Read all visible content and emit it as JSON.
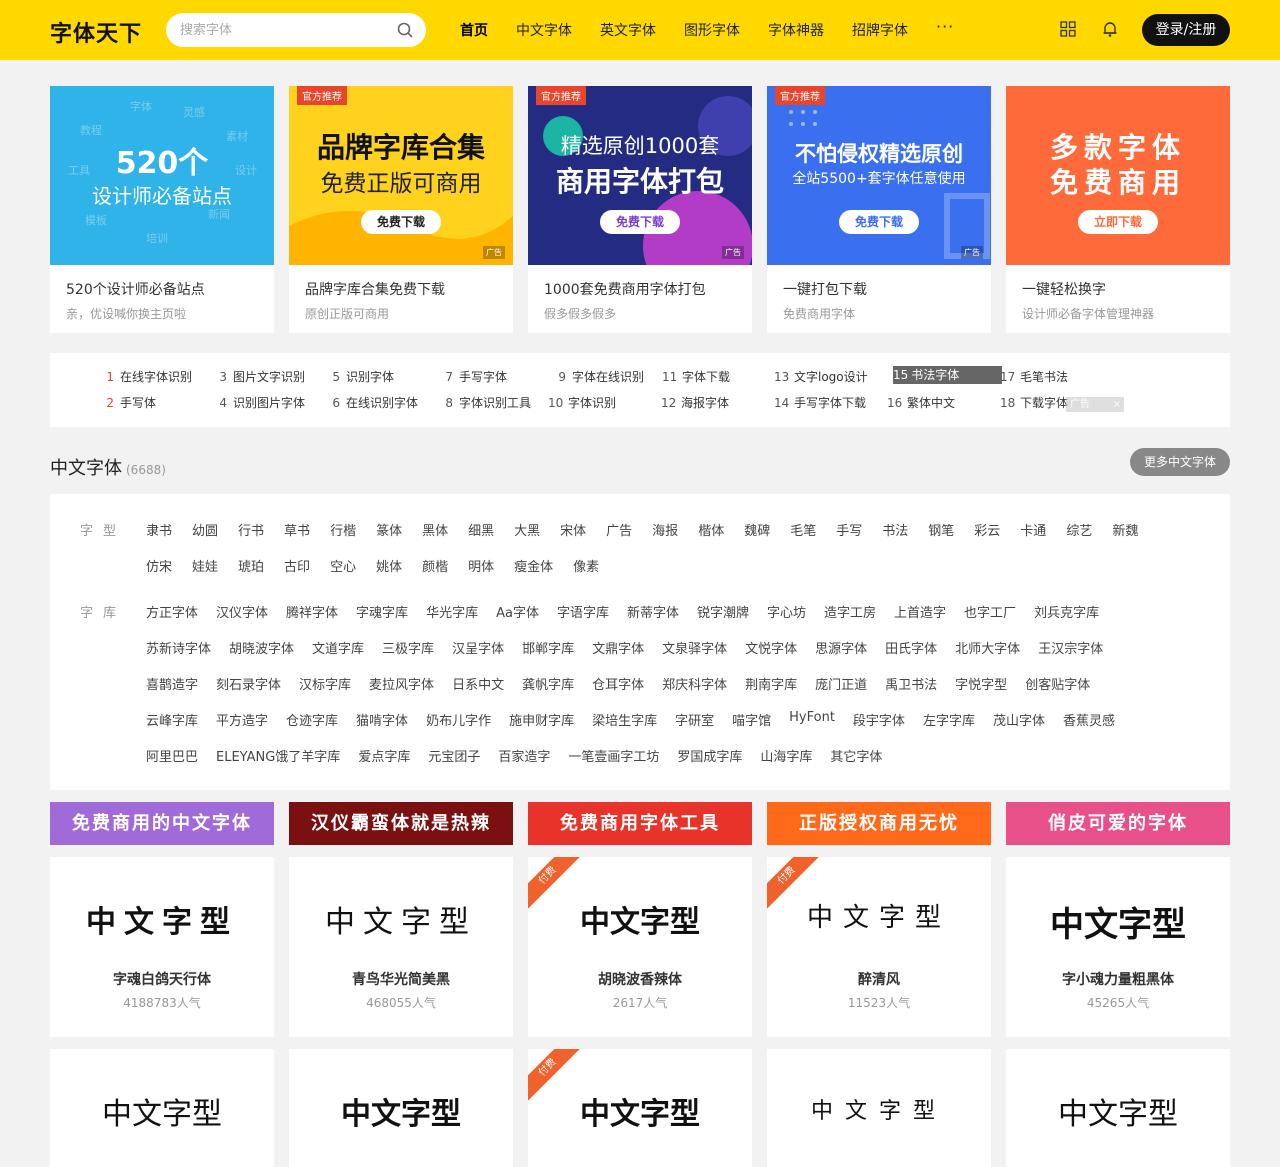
{
  "header": {
    "logo": "字体天下",
    "search_placeholder": "搜索字体",
    "nav": [
      "首页",
      "中文字体",
      "英文字体",
      "图形字体",
      "字体神器",
      "招牌字体"
    ],
    "nav_more": "···",
    "login": "登录/注册"
  },
  "banners": [
    {
      "main1": "520个",
      "main2": "设计师必备站点",
      "tag": "",
      "btn": "",
      "ad": "",
      "title": "520个设计师必备站点",
      "sub": "亲，优设喊你换主页啦",
      "bg": "#2fb3e8",
      "floats": [
        "字体",
        "灵感",
        "教程",
        "工具",
        "素材",
        "模板",
        "培训",
        "新闻",
        "设计"
      ]
    },
    {
      "main1": "品牌字库合集",
      "main2": "免费正版可商用",
      "tag": "官方推荐",
      "btn": "免费下载",
      "ad": "广告",
      "title": "品牌字库合集免费下载",
      "sub": "原创正版可商用",
      "bg": "#ffd21e"
    },
    {
      "main1": "精选原创1000套",
      "main2": "商用字体打包",
      "tag": "官方推荐",
      "btn": "免费下载",
      "ad": "广告",
      "title": "1000套免费商用字体打包",
      "sub": "假多假多假多",
      "bg": "#232b82"
    },
    {
      "main1": "不怕侵权精选原创",
      "main2": "全站5500+套字体任意使用",
      "tag": "官方推荐",
      "btn": "免费下载",
      "ad": "广告",
      "title": "一键打包下载",
      "sub": "免费商用字体",
      "bg": "#3a6ff0"
    },
    {
      "main1": "多款字体",
      "main2": "免费商用",
      "tag": "",
      "btn": "立即下载",
      "ad": "",
      "title": "一键轻松换字",
      "sub": "设计师必备字体管理神器",
      "bg": "#ff6a3b"
    }
  ],
  "hot": [
    {
      "n": "1",
      "t": "在线字体识别"
    },
    {
      "n": "2",
      "t": "手写体"
    },
    {
      "n": "3",
      "t": "图片文字识别"
    },
    {
      "n": "4",
      "t": "识别图片字体"
    },
    {
      "n": "5",
      "t": "识别字体"
    },
    {
      "n": "6",
      "t": "在线识别字体"
    },
    {
      "n": "7",
      "t": "手写字体"
    },
    {
      "n": "8",
      "t": "字体识别工具"
    },
    {
      "n": "9",
      "t": "字体在线识别"
    },
    {
      "n": "10",
      "t": "字体识别"
    },
    {
      "n": "11",
      "t": "字体下载"
    },
    {
      "n": "12",
      "t": "海报字体"
    },
    {
      "n": "13",
      "t": "文字logo设计"
    },
    {
      "n": "14",
      "t": "手写字体下载"
    },
    {
      "n": "15",
      "t": "书法字体"
    },
    {
      "n": "16",
      "t": "繁体中文"
    },
    {
      "n": "17",
      "t": "毛笔书法"
    },
    {
      "n": "18",
      "t": "下载字体"
    }
  ],
  "hot_ad": "广告",
  "hot_ad_close": "×",
  "section": {
    "title": "中文字体",
    "count": "(6688)",
    "more": "更多中文字体"
  },
  "cat": {
    "type_label": "字型",
    "lib_label": "字库",
    "types_row1": [
      "隶书",
      "幼圆",
      "行书",
      "草书",
      "行楷",
      "篆体",
      "黑体",
      "细黑",
      "大黑",
      "宋体",
      "广告",
      "海报",
      "楷体",
      "魏碑",
      "毛笔",
      "手写",
      "书法",
      "钢笔",
      "彩云",
      "卡通",
      "综艺",
      "新魏"
    ],
    "types_row2": [
      "仿宋",
      "娃娃",
      "琥珀",
      "古印",
      "空心",
      "姚体",
      "颜楷",
      "明体",
      "瘦金体",
      "像素"
    ],
    "libs_row1": [
      "方正字体",
      "汉仪字体",
      "腾祥字体",
      "字魂字库",
      "华光字库",
      "Aa字体",
      "字语字库",
      "新蒂字体",
      "锐字潮牌",
      "字心坊",
      "造字工房",
      "上首造字",
      "也字工厂",
      "刘兵克字库"
    ],
    "libs_row2": [
      "苏新诗字体",
      "胡晓波字体",
      "文道字库",
      "三极字库",
      "汉呈字体",
      "邯郸字库",
      "文鼎字体",
      "文泉驿字体",
      "文悦字体",
      "思源字体",
      "田氏字体",
      "北师大字体",
      "王汉宗字体"
    ],
    "libs_row3": [
      "喜鹊造字",
      "刻石录字体",
      "汉标字库",
      "麦拉风字体",
      "日系中文",
      "龚帆字库",
      "仓耳字体",
      "郑庆科字体",
      "荆南字库",
      "庞门正道",
      "禹卫书法",
      "字悦字型",
      "创客贴字体"
    ],
    "libs_row4": [
      "云峰字库",
      "平方造字",
      "仓迹字库",
      "猫啃字体",
      "奶布儿字作",
      "施申财字库",
      "梁培生字库",
      "字研室",
      "喵字馆",
      "HyFont",
      "段宇字体",
      "左字字库",
      "茂山字体",
      "香蕉灵感"
    ],
    "libs_row5": [
      "阿里巴巴",
      "ELEYANG饿了羊字库",
      "爱点字库",
      "元宝团子",
      "百家造字",
      "一笔壹画字工坊",
      "罗国成字库",
      "山海字库",
      "其它字体"
    ]
  },
  "cbanners": [
    {
      "t": "免费商用的中文字体",
      "bg": "#a06ad8"
    },
    {
      "t": "汉仪霸蛮体就是热辣",
      "bg": "#7a1010"
    },
    {
      "t": "免费商用字体工具",
      "bg": "#e8332b"
    },
    {
      "t": "正版授权商用无忧",
      "bg": "#ff6a1a"
    },
    {
      "t": "俏皮可爱的字体",
      "bg": "#e8508a"
    }
  ],
  "fonts_row1": [
    {
      "s": "中文字型",
      "name": "字魂白鸽天行体",
      "pop": "4188783人气",
      "paid": ""
    },
    {
      "s": "中文字型",
      "name": "青鸟华光简美黑",
      "pop": "468055人气",
      "paid": ""
    },
    {
      "s": "中文字型",
      "name": "胡晓波香辣体",
      "pop": "2617人气",
      "paid": "付费"
    },
    {
      "s": "中文字型",
      "name": "醉清风",
      "pop": "11523人气",
      "paid": "付费"
    },
    {
      "s": "中文字型",
      "name": "字小魂力量粗黑体",
      "pop": "45265人气",
      "paid": ""
    }
  ],
  "fonts_row2": [
    {
      "s": "中文字型",
      "paid": ""
    },
    {
      "s": "中文字型",
      "paid": ""
    },
    {
      "s": "中文字型",
      "paid": "付费"
    },
    {
      "s": "中文字型",
      "paid": ""
    },
    {
      "s": "中文字型",
      "paid": ""
    }
  ]
}
